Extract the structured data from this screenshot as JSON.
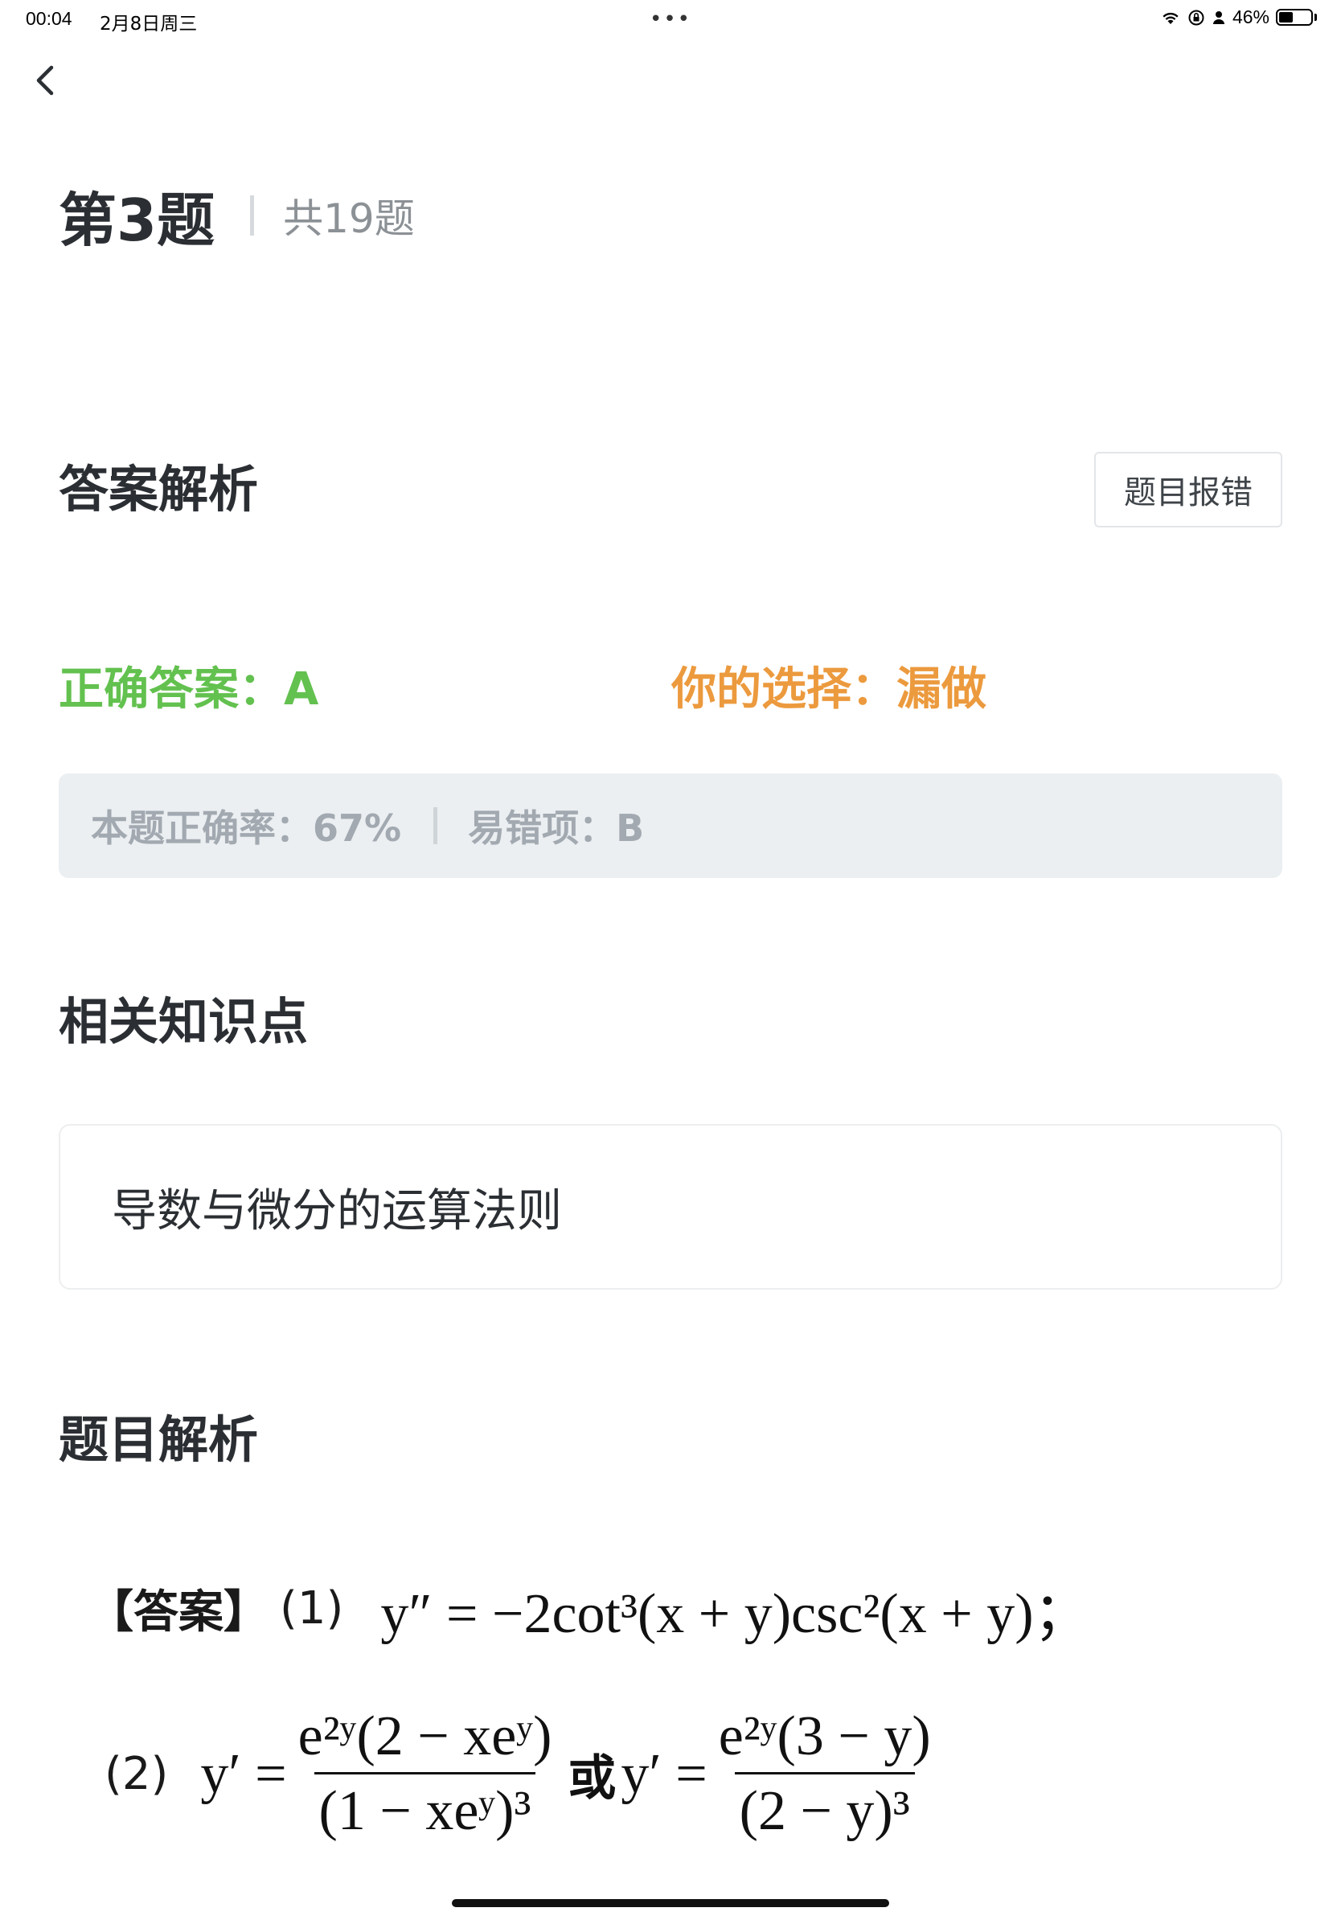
{
  "status_bar": {
    "time": "00:04",
    "date": "2月8日周三",
    "dots": "•••",
    "battery": "46%",
    "battery_level": 0.46
  },
  "header": {
    "question_label": "第3题",
    "total_label": "共19题"
  },
  "answer_section": {
    "title": "答案解析",
    "report_button": "题目报错",
    "correct_answer": "正确答案：A",
    "your_choice": "你的选择：漏做"
  },
  "stats": {
    "accuracy": "本题正确率：67%",
    "common_wrong": "易错项：B"
  },
  "knowledge": {
    "title": "相关知识点",
    "item": "导数与微分的运算法则"
  },
  "analysis": {
    "title": "题目解析",
    "answer_tag": "【答案】",
    "part1_label": "(1)",
    "part1_formula": "y″ = −2cot³(x + y)csc²(x + y)；",
    "part2_label": "(2)",
    "part2_lhs": "y′ =",
    "part2_num1": "e²ʸ(2 − xeʸ)",
    "part2_den1": "(1 − xeʸ)³",
    "part2_or": "或",
    "part2_lhs2": "y′ =",
    "part2_num2": "e²ʸ(3 − y)",
    "part2_den2": "(2 − y)³"
  },
  "colors": {
    "correct": "#63c14f",
    "choice": "#ec9a3e",
    "muted": "#a2a9b0"
  }
}
